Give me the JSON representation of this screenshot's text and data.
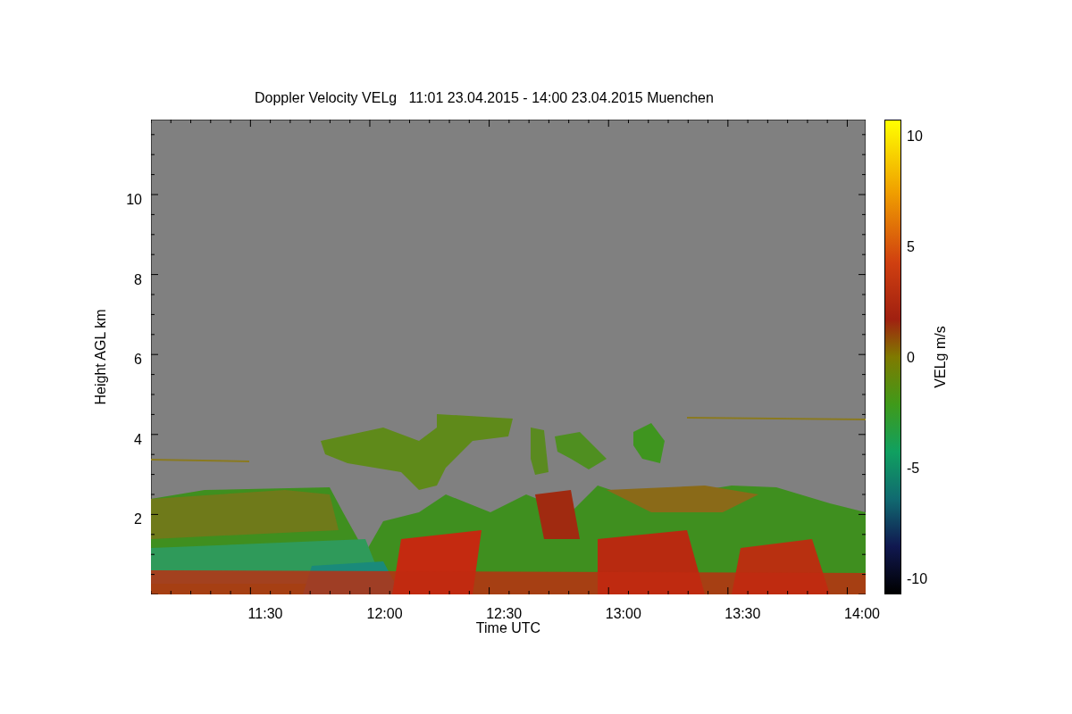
{
  "title": "Doppler Velocity VELg   11:01 23.04.2015 - 14:00 23.04.2015 Muenchen",
  "y_axis": {
    "label": "Height AGL km",
    "ticks": [
      "10",
      "8",
      "6",
      "4",
      "2"
    ]
  },
  "x_axis": {
    "label": "Time UTC",
    "ticks": [
      "11:30",
      "12:00",
      "12:30",
      "13:00",
      "13:30",
      "14:00"
    ]
  },
  "colorbar": {
    "label": "VELg m/s",
    "ticks": [
      "10",
      "5",
      "0",
      "-5",
      "-10"
    ]
  }
}
